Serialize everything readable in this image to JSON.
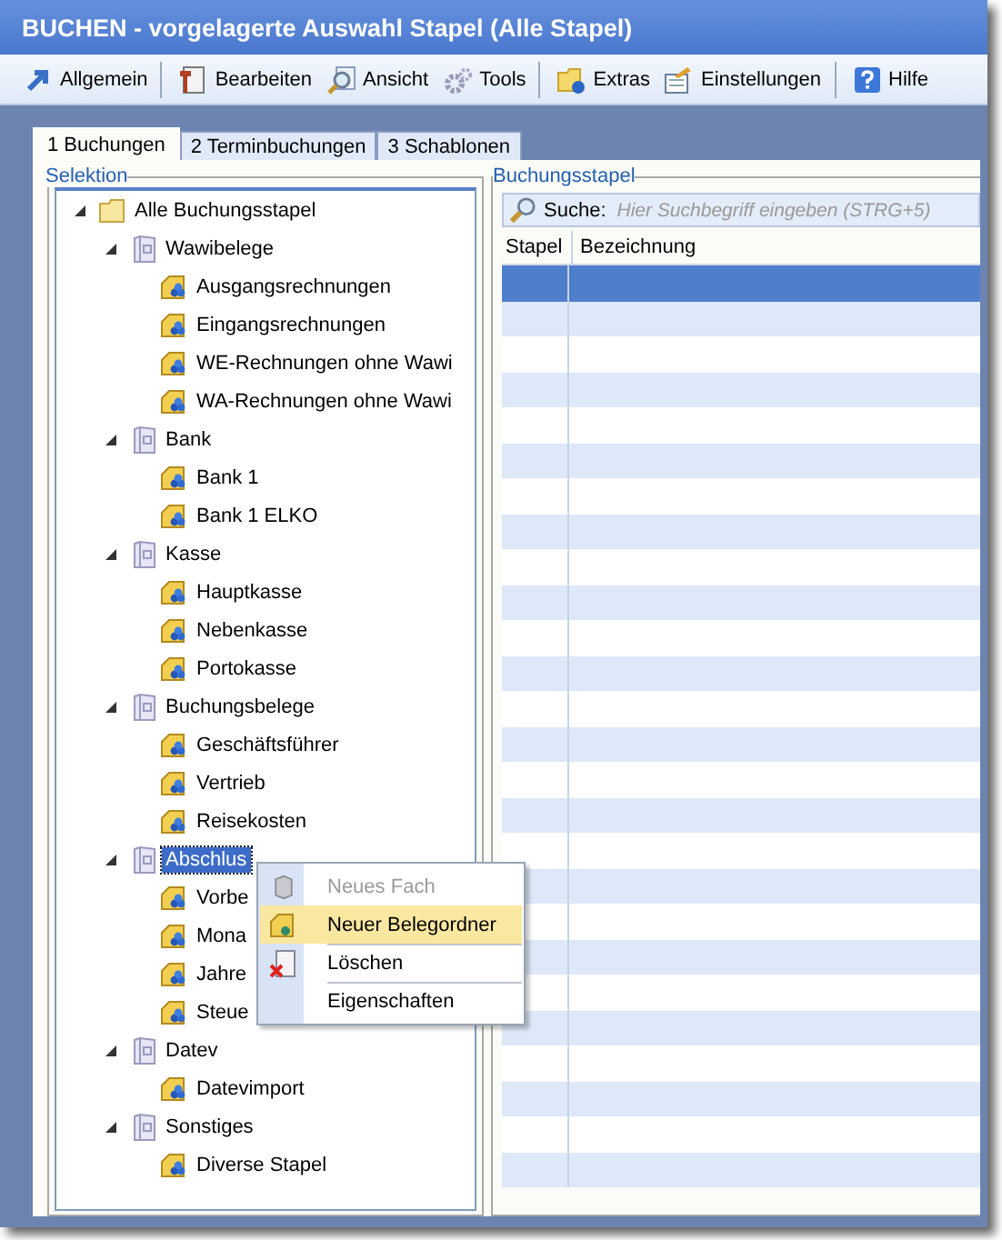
{
  "window": {
    "title": "BUCHEN - vorgelagerte Auswahl Stapel (Alle Stapel)"
  },
  "toolbar": [
    {
      "label": "Allgemein",
      "separator_after": true
    },
    {
      "label": "Bearbeiten",
      "separator_after": false
    },
    {
      "label": "Ansicht",
      "separator_after": false
    },
    {
      "label": "Tools",
      "separator_after": true
    },
    {
      "label": "Extras",
      "separator_after": false
    },
    {
      "label": "Einstellungen",
      "separator_after": true
    },
    {
      "label": "Hilfe",
      "separator_after": false
    }
  ],
  "tabs": [
    {
      "label": "1 Buchungen",
      "selected": true
    },
    {
      "label": "2 Terminbuchungen",
      "selected": false
    },
    {
      "label": "3 Schablonen",
      "selected": false
    }
  ],
  "selection": {
    "title": "Selektion",
    "tree": [
      {
        "label": "Alle Buchungsstapel",
        "kind": "root",
        "expanded": true,
        "selected": false,
        "children": [
          {
            "label": "Wawibelege",
            "kind": "group",
            "expanded": true,
            "selected": false,
            "children": [
              {
                "label": "Ausgangsrechnungen",
                "kind": "folder",
                "selected": false
              },
              {
                "label": "Eingangsrechnungen",
                "kind": "folder",
                "selected": false
              },
              {
                "label": "WE-Rechnungen ohne Wawi",
                "kind": "folder",
                "selected": false
              },
              {
                "label": "WA-Rechnungen ohne Wawi",
                "kind": "folder",
                "selected": false
              }
            ]
          },
          {
            "label": "Bank",
            "kind": "group",
            "expanded": true,
            "selected": false,
            "children": [
              {
                "label": "Bank 1",
                "kind": "folder",
                "selected": false
              },
              {
                "label": "Bank 1 ELKO",
                "kind": "folder",
                "selected": false
              }
            ]
          },
          {
            "label": "Kasse",
            "kind": "group",
            "expanded": true,
            "selected": false,
            "children": [
              {
                "label": "Hauptkasse",
                "kind": "folder",
                "selected": false
              },
              {
                "label": "Nebenkasse",
                "kind": "folder",
                "selected": false
              },
              {
                "label": "Portokasse",
                "kind": "folder",
                "selected": false
              }
            ]
          },
          {
            "label": "Buchungsbelege",
            "kind": "group",
            "expanded": true,
            "selected": false,
            "children": [
              {
                "label": "Geschäftsführer",
                "kind": "folder",
                "selected": false
              },
              {
                "label": "Vertrieb",
                "kind": "folder",
                "selected": false
              },
              {
                "label": "Reisekosten",
                "kind": "folder",
                "selected": false
              }
            ]
          },
          {
            "label": "Abschlus",
            "kind": "group",
            "expanded": true,
            "selected": true,
            "children": [
              {
                "label": "Vorbe",
                "kind": "folder",
                "selected": false
              },
              {
                "label": "Mona",
                "kind": "folder",
                "selected": false
              },
              {
                "label": "Jahre",
                "kind": "folder",
                "selected": false
              },
              {
                "label": "Steue",
                "kind": "folder",
                "selected": false
              }
            ]
          },
          {
            "label": "Datev",
            "kind": "group",
            "expanded": true,
            "selected": false,
            "children": [
              {
                "label": "Datevimport",
                "kind": "folder",
                "selected": false
              }
            ]
          },
          {
            "label": "Sonstiges",
            "kind": "group",
            "expanded": true,
            "selected": false,
            "children": [
              {
                "label": "Diverse Stapel",
                "kind": "folder",
                "selected": false
              }
            ]
          }
        ]
      }
    ]
  },
  "context_menu": [
    {
      "label": "Neues Fach",
      "disabled": true,
      "selected": false,
      "divider_above": false
    },
    {
      "label": "Neuer Belegordner",
      "disabled": false,
      "selected": true,
      "divider_above": false
    },
    {
      "label": "Löschen",
      "disabled": false,
      "selected": false,
      "divider_above": true
    },
    {
      "label": "Eigenschaften",
      "disabled": false,
      "selected": false,
      "divider_above": true
    }
  ],
  "stacks": {
    "title": "Buchungsstapel",
    "search": {
      "label": "Suche:",
      "placeholder": "Hier Suchbegriff eingeben (STRG+5)"
    },
    "table": {
      "columns": [
        "Stapel",
        "Bezeichnung"
      ],
      "rows": [
        {
          "selected": true
        },
        {
          "selected": false
        },
        {
          "selected": false
        },
        {
          "selected": false
        },
        {
          "selected": false
        },
        {
          "selected": false
        },
        {
          "selected": false
        },
        {
          "selected": false
        },
        {
          "selected": false
        },
        {
          "selected": false
        },
        {
          "selected": false
        },
        {
          "selected": false
        },
        {
          "selected": false
        },
        {
          "selected": false
        },
        {
          "selected": false
        },
        {
          "selected": false
        },
        {
          "selected": false
        },
        {
          "selected": false
        },
        {
          "selected": false
        },
        {
          "selected": false
        },
        {
          "selected": false
        },
        {
          "selected": false
        },
        {
          "selected": false
        },
        {
          "selected": false
        },
        {
          "selected": false
        },
        {
          "selected": false
        }
      ]
    }
  }
}
